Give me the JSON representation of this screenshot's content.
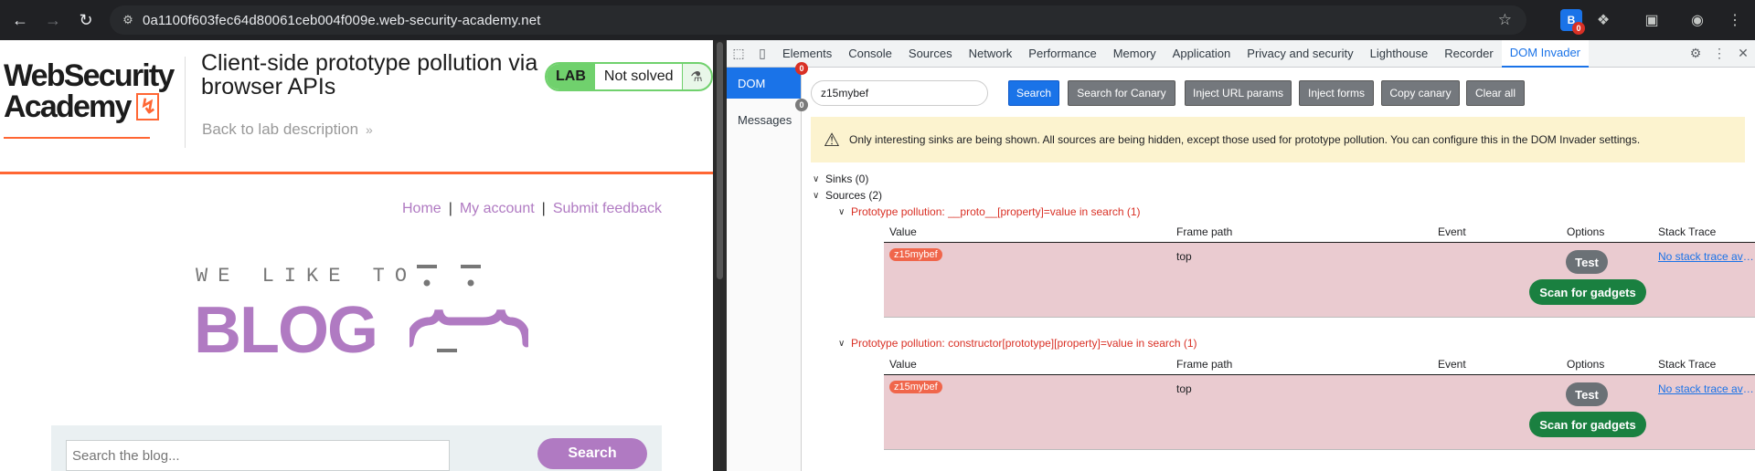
{
  "browser": {
    "url": "0a1100f603fec64d80061ceb004f009e.web-security-academy.net",
    "extension_badge": "0"
  },
  "lab": {
    "logo_line1": "WebSecurity",
    "logo_line2": "Academy",
    "title": "Client-side prototype pollution via browser APIs",
    "back_link": "Back to lab description",
    "status_label": "LAB",
    "status_text": "Not solved",
    "nav": {
      "home": "Home",
      "separator": "|",
      "my_account": "My account",
      "submit_feedback": "Submit feedback"
    },
    "hero_tagline": "WE LIKE TO",
    "hero_title": "BLOG",
    "search_placeholder": "Search the blog...",
    "search_button": "Search"
  },
  "devtools": {
    "tabs": [
      "Elements",
      "Console",
      "Sources",
      "Network",
      "Performance",
      "Memory",
      "Application",
      "Privacy and security",
      "Lighthouse",
      "Recorder",
      "DOM Invader"
    ],
    "active_tab": "DOM Invader",
    "side": [
      {
        "label": "DOM",
        "badge": "0"
      },
      {
        "label": "Messages",
        "badge": "0"
      }
    ],
    "canary_value": "z15mybef",
    "buttons": {
      "search": "Search",
      "search_canary": "Search for Canary",
      "inject_url": "Inject URL params",
      "inject_forms": "Inject forms",
      "copy_canary": "Copy canary",
      "clear_all": "Clear all"
    },
    "warning": "Only interesting sinks are being shown. All sources are being hidden, except those used for prototype pollution. You can configure this in the DOM Invader settings.",
    "sinks_label": "Sinks (0)",
    "sources_label": "Sources (2)",
    "table_headers": {
      "value": "Value",
      "frame_path": "Frame path",
      "event": "Event",
      "options": "Options",
      "stack_trace": "Stack Trace"
    },
    "sources": [
      {
        "title": "Prototype pollution: __proto__[property]=value in search (1)",
        "value": "z15mybef",
        "frame": "top",
        "test": "Test",
        "gadgets": "Scan for gadgets",
        "stack": "No stack trace available"
      },
      {
        "title": "Prototype pollution: constructor[prototype][property]=value in search (1)",
        "value": "z15mybef",
        "frame": "top",
        "test": "Test",
        "gadgets": "Scan for gadgets",
        "stack": "No stack trace available"
      }
    ]
  }
}
